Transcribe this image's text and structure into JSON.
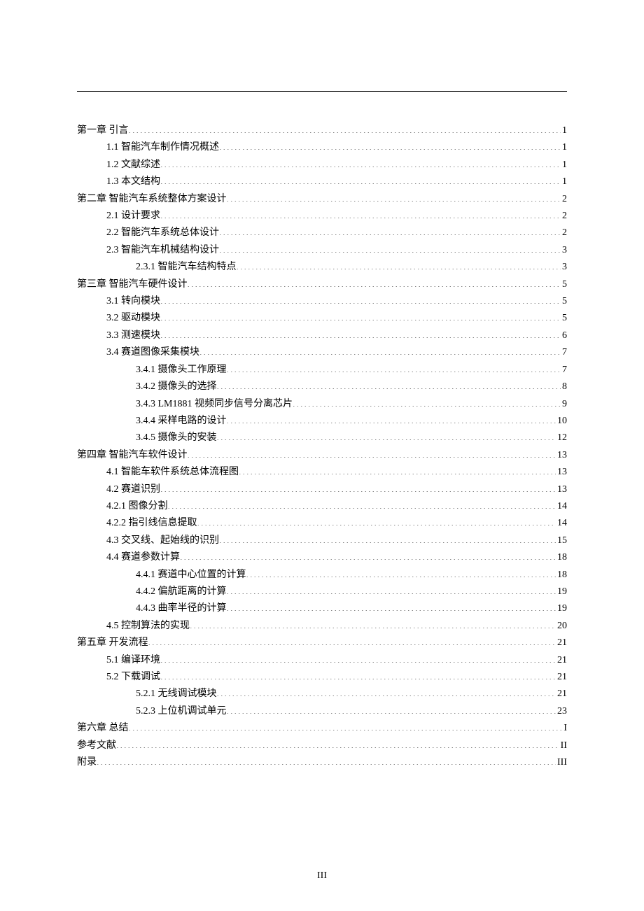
{
  "footer": {
    "page": "III"
  },
  "toc": [
    {
      "lvl": 0,
      "num": "第一章",
      "sep": "  ",
      "title": "引言",
      "page": "1"
    },
    {
      "lvl": 1,
      "num": "1.1",
      "sep": "  ",
      "title": "智能汽车制作情况概述",
      "page": "1"
    },
    {
      "lvl": 1,
      "num": "1.2",
      "sep": "  ",
      "title": "文献综述",
      "page": "1"
    },
    {
      "lvl": 1,
      "num": "1.3",
      "sep": "  ",
      "title": "本文结构",
      "page": "1"
    },
    {
      "lvl": 0,
      "num": "第二章",
      "sep": "        ",
      "title": "智能汽车系统整体方案设计",
      "page": "2"
    },
    {
      "lvl": 1,
      "num": "2.1",
      "sep": " ",
      "title": "设计要求",
      "page": "2"
    },
    {
      "lvl": 1,
      "num": "2.2",
      "sep": " ",
      "title": "智能汽车系统总体设计",
      "page": "2"
    },
    {
      "lvl": 1,
      "num": "2.3",
      "sep": " ",
      "title": "智能汽车机械结构设计",
      "page": "3"
    },
    {
      "lvl": 2,
      "num": "2.3.1",
      "sep": " ",
      "title": "智能汽车结构特点",
      "page": "3"
    },
    {
      "lvl": 0,
      "num": "第三章",
      "sep": " ",
      "title": "智能汽车硬件设计",
      "page": "5"
    },
    {
      "lvl": 1,
      "num": "3.1",
      "sep": " ",
      "title": "转向模块",
      "page": "5"
    },
    {
      "lvl": 1,
      "num": "3.2",
      "sep": " ",
      "title": "驱动模块",
      "page": "5"
    },
    {
      "lvl": 1,
      "num": "3.3",
      "sep": " ",
      "title": "测速模块",
      "page": "6"
    },
    {
      "lvl": 1,
      "num": "3.4",
      "sep": " ",
      "title": "赛道图像采集模块",
      "page": "7"
    },
    {
      "lvl": 2,
      "num": "3.4.1",
      "sep": " ",
      "title": "摄像头工作原理",
      "page": "7"
    },
    {
      "lvl": 2,
      "num": "3.4.2",
      "sep": " ",
      "title": "摄像头的选择",
      "page": "8"
    },
    {
      "lvl": 2,
      "num": "3.4.3",
      "sep": " ",
      "title": "LM1881 视频同步信号分离芯片",
      "page": "9"
    },
    {
      "lvl": 2,
      "num": "3.4.4",
      "sep": " ",
      "title": "采样电路的设计",
      "page": "10"
    },
    {
      "lvl": 2,
      "num": "3.4.5",
      "sep": " ",
      "title": "摄像头的安装",
      "page": "12"
    },
    {
      "lvl": 0,
      "num": "第四章",
      "sep": " ",
      "title": "智能汽车软件设计",
      "page": "13"
    },
    {
      "lvl": 1,
      "num": "4.1",
      "sep": " ",
      "title": "智能车软件系统总体流程图",
      "page": "13"
    },
    {
      "lvl": 1,
      "num": "4.2",
      "sep": " ",
      "title": "赛道识别",
      "page": "13"
    },
    {
      "lvl": 1,
      "num": "4.2.1",
      "sep": " ",
      "title": "图像分割",
      "page": "14"
    },
    {
      "lvl": 1,
      "num": "4.2.2",
      "sep": " ",
      "title": "指引线信息提取",
      "page": "14"
    },
    {
      "lvl": 1,
      "num": "4.3",
      "sep": " ",
      "title": "交叉线、起始线的识别",
      "page": "15"
    },
    {
      "lvl": 1,
      "num": "4.4",
      "sep": " ",
      "title": "赛道参数计算",
      "page": "18"
    },
    {
      "lvl": 2,
      "num": "4.4.1",
      "sep": " ",
      "title": "赛道中心位置的计算",
      "page": "18"
    },
    {
      "lvl": 2,
      "num": "4.4.2",
      "sep": " ",
      "title": "偏航距离的计算",
      "page": "19"
    },
    {
      "lvl": 2,
      "num": "4.4.3",
      "sep": " ",
      "title": "曲率半径的计算",
      "page": "19"
    },
    {
      "lvl": 1,
      "num": "4.5",
      "sep": " ",
      "title": "控制算法的实现",
      "page": "20"
    },
    {
      "lvl": 0,
      "num": "第五章",
      "sep": " ",
      "title": "开发流程",
      "page": "21"
    },
    {
      "lvl": 1,
      "num": "5.1",
      "sep": " ",
      "title": "编译环境",
      "page": "21"
    },
    {
      "lvl": 1,
      "num": "5.2",
      "sep": " ",
      "title": "下载调试",
      "page": "21"
    },
    {
      "lvl": 2,
      "num": "5.2.1",
      "sep": " ",
      "title": "无线调试模块",
      "page": "21"
    },
    {
      "lvl": 2,
      "num": "5.2.3",
      "sep": " ",
      "title": "上位机调试单元",
      "page": "23"
    },
    {
      "lvl": 0,
      "num": "第六章",
      "sep": " ",
      "title": "总结",
      "page": "I"
    },
    {
      "lvl": 0,
      "num": "",
      "sep": "",
      "title": "参考文献",
      "page": "II"
    },
    {
      "lvl": 0,
      "num": "",
      "sep": "",
      "title": "附录",
      "page": "III"
    }
  ]
}
